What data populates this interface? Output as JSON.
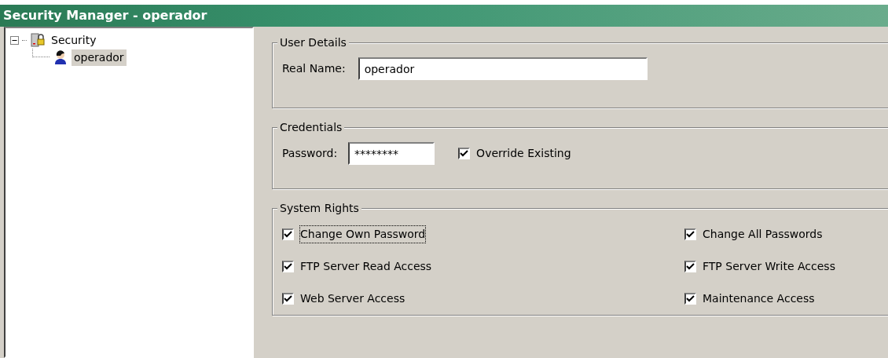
{
  "window": {
    "title": "Security Manager - operador"
  },
  "tree": [
    {
      "label": "Security",
      "expanded": true,
      "selected": false,
      "children": [
        {
          "label": "operador",
          "selected": true
        }
      ]
    }
  ],
  "user_details": {
    "title": "User Details",
    "real_name_label": "Real Name:",
    "real_name_value": "operador"
  },
  "credentials": {
    "title": "Credentials",
    "password_label": "Password:",
    "password_value": "********",
    "override": {
      "label": "Override Existing",
      "checked": true
    }
  },
  "system_rights": {
    "title": "System Rights",
    "items": [
      {
        "label": "Change Own Password",
        "checked": true,
        "focused": true
      },
      {
        "label": "Change All Passwords",
        "checked": true,
        "focused": false
      },
      {
        "label": "FTP Server Read Access",
        "checked": true,
        "focused": false
      },
      {
        "label": "FTP Server Write Access",
        "checked": true,
        "focused": false
      },
      {
        "label": "Web Server Access",
        "checked": true,
        "focused": false
      },
      {
        "label": "Maintenance Access",
        "checked": true,
        "focused": false
      }
    ]
  }
}
